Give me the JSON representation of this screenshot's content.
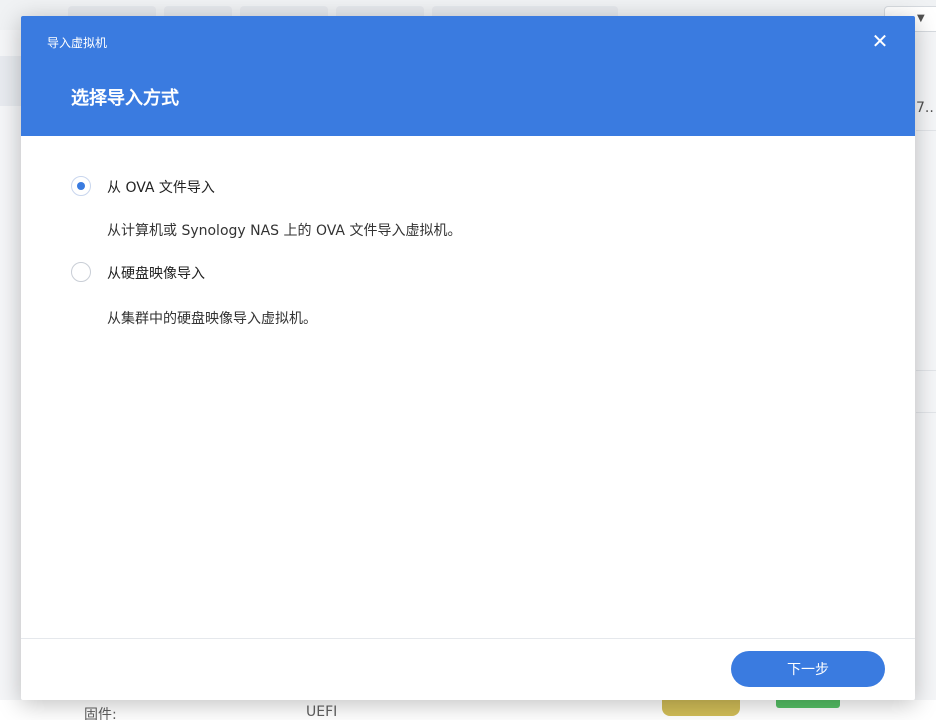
{
  "background": {
    "right_partial_text": "7..",
    "bottom_label": "固件:",
    "bottom_value": "UEFI"
  },
  "dialog": {
    "window_title": "导入虚拟机",
    "close_glyph": "✕",
    "step_title": "选择导入方式",
    "options": [
      {
        "label": "从 OVA 文件导入",
        "description": "从计算机或 Synology NAS 上的 OVA 文件导入虚拟机。",
        "checked": true
      },
      {
        "label": "从硬盘映像导入",
        "description": "从集群中的硬盘映像导入虚拟机。",
        "checked": false
      }
    ],
    "next_label": "下一步"
  },
  "colors": {
    "accent": "#3a7be0",
    "header_text": "#ffffff"
  },
  "icons": {
    "close": "close-icon",
    "dropdown": "chevron-down-icon"
  }
}
